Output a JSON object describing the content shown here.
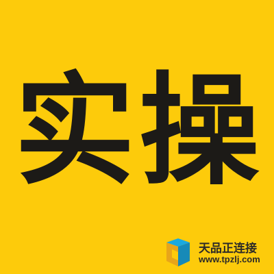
{
  "headline": {
    "chars": [
      "实",
      "操"
    ]
  },
  "watermark": {
    "brand_name": "天品正连接",
    "url": "www.tpzlj.com"
  },
  "colors": {
    "background": "#FDCB0B",
    "headline": "#1C1A17",
    "watermark_text": "#2C2A28",
    "logo_cyan": "#1BA9DF",
    "logo_teal": "#178AB8",
    "logo_orange": "#E8A51A"
  }
}
